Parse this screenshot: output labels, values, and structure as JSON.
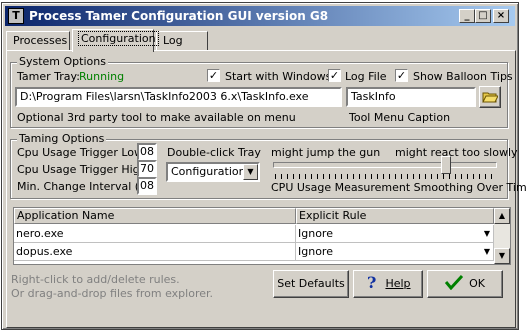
{
  "window": {
    "title": "Process Tamer Configuration GUI version G8",
    "icon": "process-tamer-icon"
  },
  "tabs": [
    {
      "label": "Processes",
      "active": false
    },
    {
      "label": "Configuration",
      "active": true
    },
    {
      "label": "Log",
      "active": false
    }
  ],
  "system_options": {
    "group_label": "System Options",
    "tray_label": "Tamer Tray:",
    "tray_status": "Running",
    "start_with_windows": {
      "label": "Start with Windows",
      "checked": true
    },
    "log_file": {
      "label": "Log File",
      "checked": true
    },
    "balloon_tips": {
      "label": "Show Balloon Tips",
      "checked": true
    },
    "tool_path": "D:\\Program Files\\larsn\\TaskInfo2003 6.x\\TaskInfo.exe",
    "tool_caption": "TaskInfo",
    "tool_path_caption": "Optional 3rd party tool to make available on menu",
    "tool_caption_label": "Tool Menu Caption"
  },
  "taming_options": {
    "group_label": "Taming Options",
    "trigger_low_label": "Cpu Usage Trigger Low",
    "trigger_low_value": "08",
    "trigger_high_label": "Cpu Usage Trigger High",
    "trigger_high_value": "70",
    "min_change_label": "Min. Change Interval (s.)",
    "min_change_value": "08",
    "double_click_label": "Double-click Tray",
    "double_click_value": "Configuration",
    "slider_left_label": "might jump the gun",
    "slider_right_label": "might react too slowly",
    "slider_caption": "CPU Usage Measurement Smoothing Over Time",
    "slider_level": 0.78
  },
  "rules_table": {
    "columns": [
      "Application Name",
      "Explicit Rule"
    ],
    "rows": [
      [
        "nero.exe",
        "Ignore"
      ],
      [
        "dopus.exe",
        "Ignore"
      ]
    ]
  },
  "footer": {
    "hint_line1": "Right-click to add/delete rules.",
    "hint_line2": "Or drag-and-drop files from explorer.",
    "set_defaults_label": "Set Defaults",
    "help_label": "Help",
    "ok_label": "OK"
  }
}
